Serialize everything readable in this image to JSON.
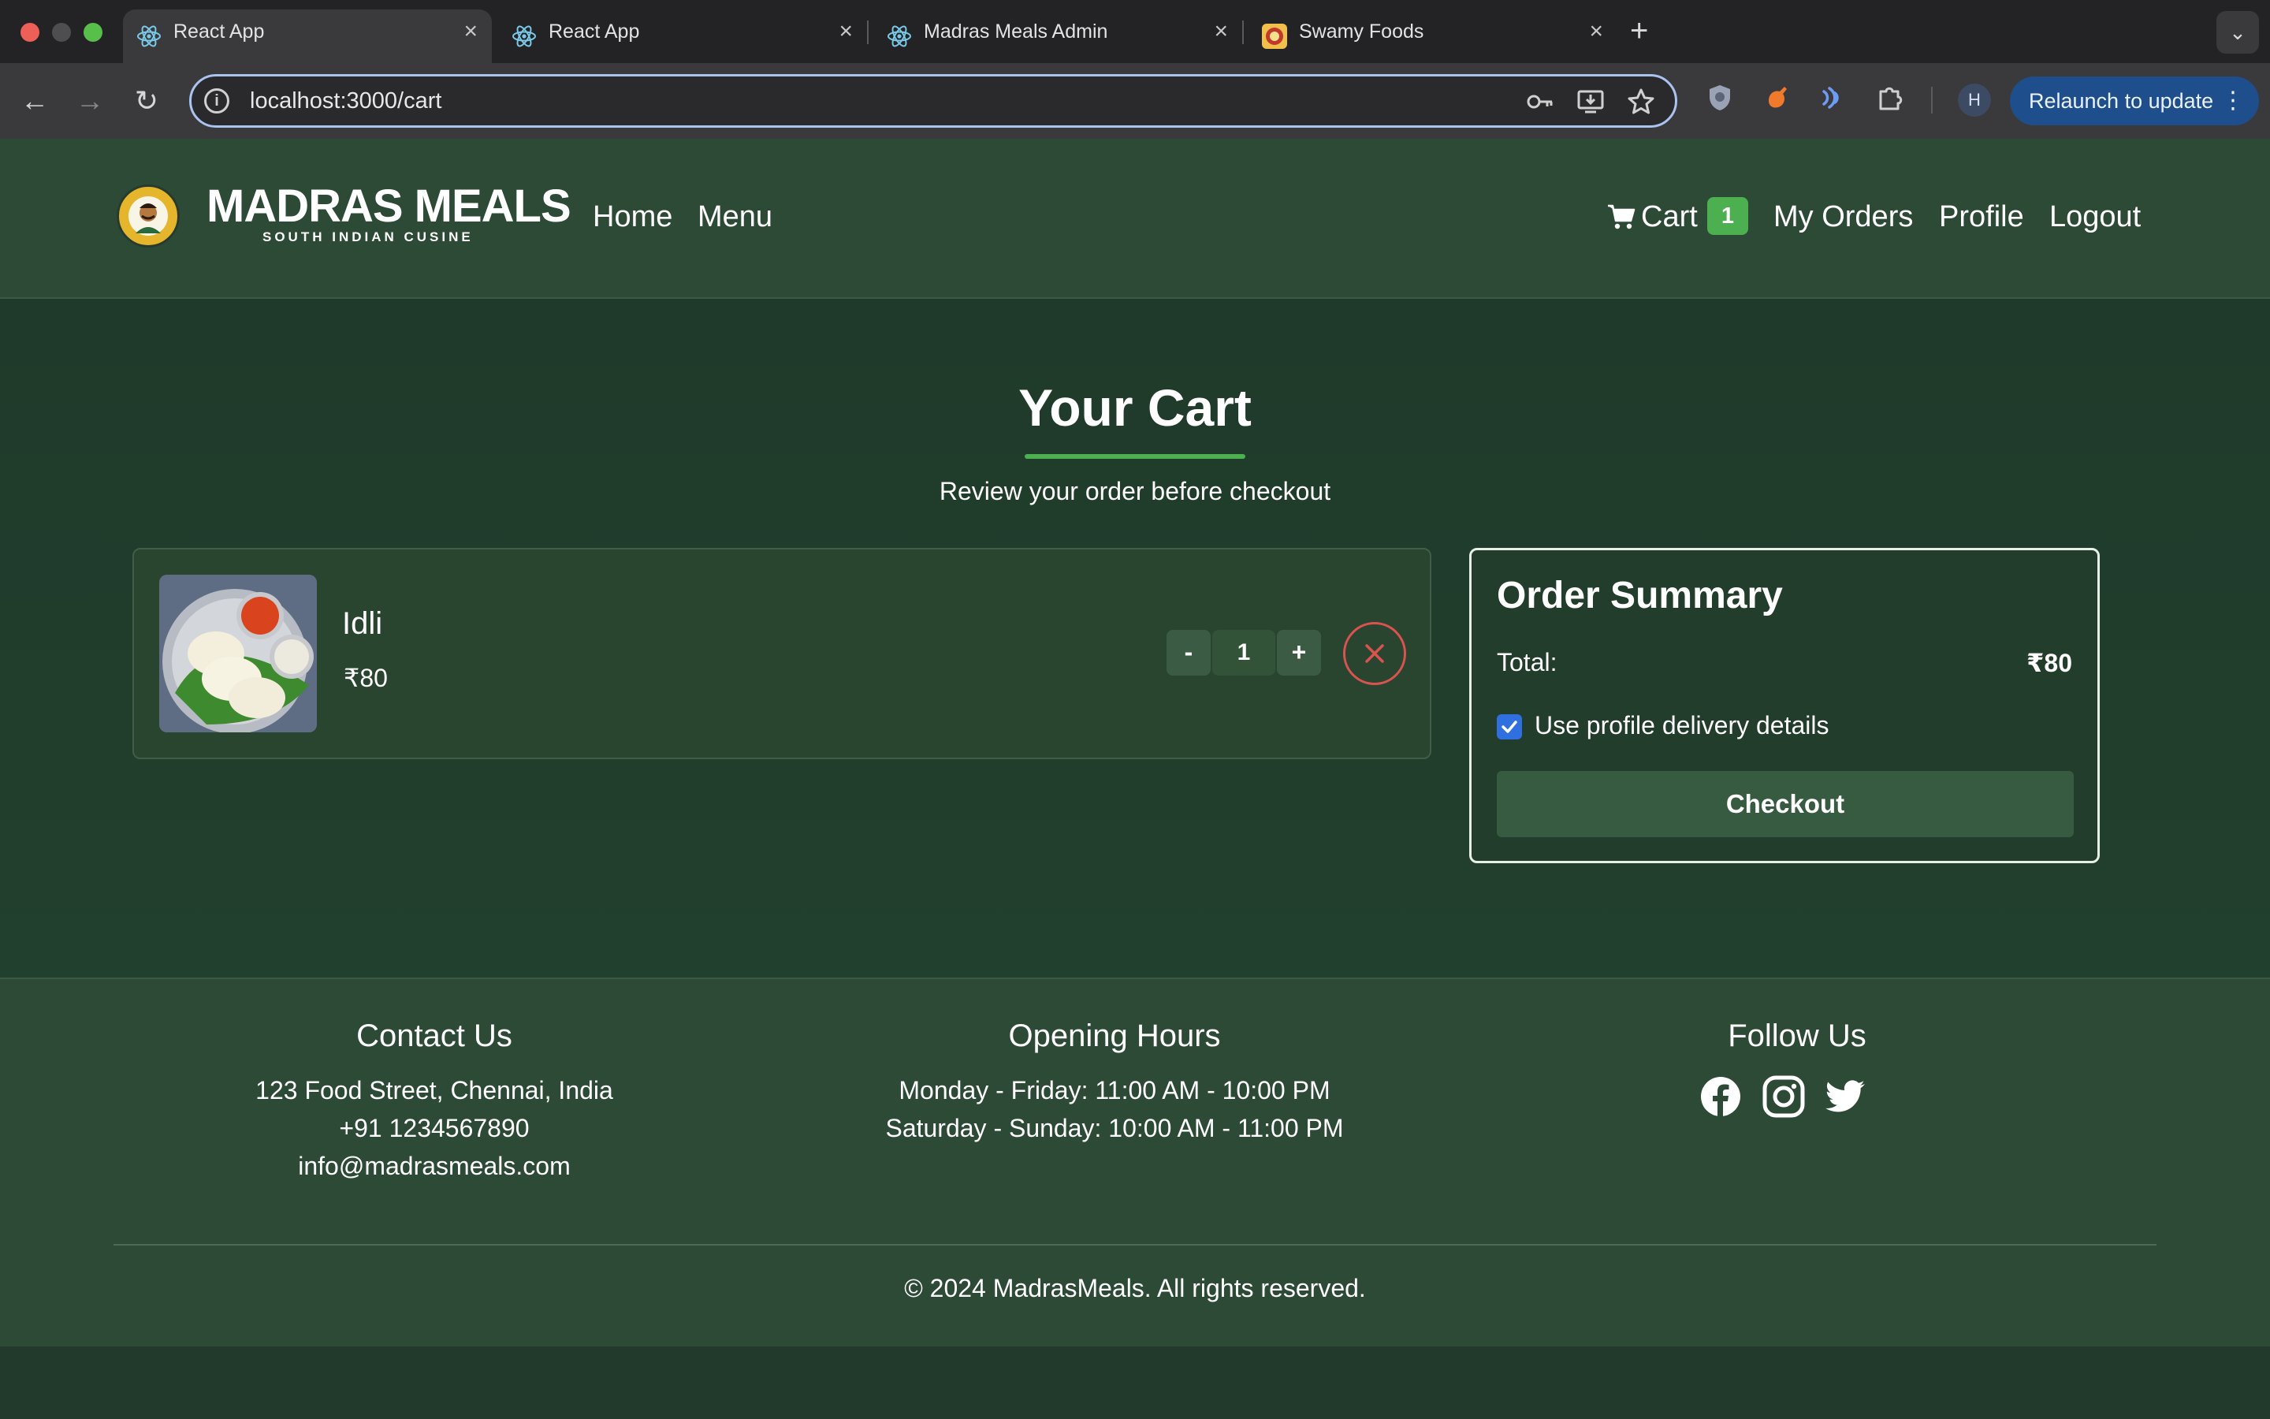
{
  "browser": {
    "tabs": [
      {
        "title": "React App",
        "icon": "react-icon",
        "active": true
      },
      {
        "title": "React App",
        "icon": "react-icon",
        "active": false
      },
      {
        "title": "Madras Meals Admin",
        "icon": "react-icon",
        "active": false
      },
      {
        "title": "Swamy Foods",
        "icon": "swamy-foods-favicon",
        "active": false
      }
    ],
    "tab_close": "×",
    "new_tab": "+",
    "tab_menu": "⌄",
    "back": "←",
    "forward": "→",
    "reload": "↻",
    "url": "localhost:3000/cart",
    "relaunch_label": "Relaunch to update",
    "relaunch_more": "⋮",
    "profile_initial": "H"
  },
  "site": {
    "logo_title": "MADRAS MEALS",
    "logo_subtitle": "SOUTH INDIAN CUSINE",
    "nav_left": [
      "Home",
      "Menu"
    ],
    "cart_label": "Cart",
    "cart_count": "1",
    "nav_right": [
      "My Orders",
      "Profile",
      "Logout"
    ]
  },
  "cart_page": {
    "title": "Your Cart",
    "subtitle": "Review your order before checkout",
    "items": [
      {
        "name": "Idli",
        "price": "₹80",
        "quantity": "1",
        "decrement": "-",
        "increment": "+"
      }
    ],
    "summary": {
      "title": "Order Summary",
      "total_label": "Total:",
      "total_value": "₹80",
      "use_profile_label": "Use profile delivery details",
      "use_profile_checked": true,
      "checkout_label": "Checkout"
    }
  },
  "footer": {
    "contact": {
      "heading": "Contact Us",
      "lines": [
        "123 Food Street, Chennai, India",
        "+91 1234567890",
        "info@madrasmeals.com"
      ]
    },
    "hours": {
      "heading": "Opening Hours",
      "lines": [
        "Monday - Friday: 11:00 AM - 10:00 PM",
        "Saturday - Sunday: 10:00 AM - 11:00 PM"
      ]
    },
    "follow": {
      "heading": "Follow Us",
      "icons": [
        "facebook-icon",
        "instagram-icon",
        "twitter-icon"
      ]
    },
    "copyright": "© 2024 MadrasMeals. All rights reserved."
  },
  "colors": {
    "accent": "#4caf50",
    "header_bg": "#2c4a36",
    "page_bg": "#223a2c",
    "remove": "#d9534f",
    "checkbox": "#2f6fe0"
  }
}
